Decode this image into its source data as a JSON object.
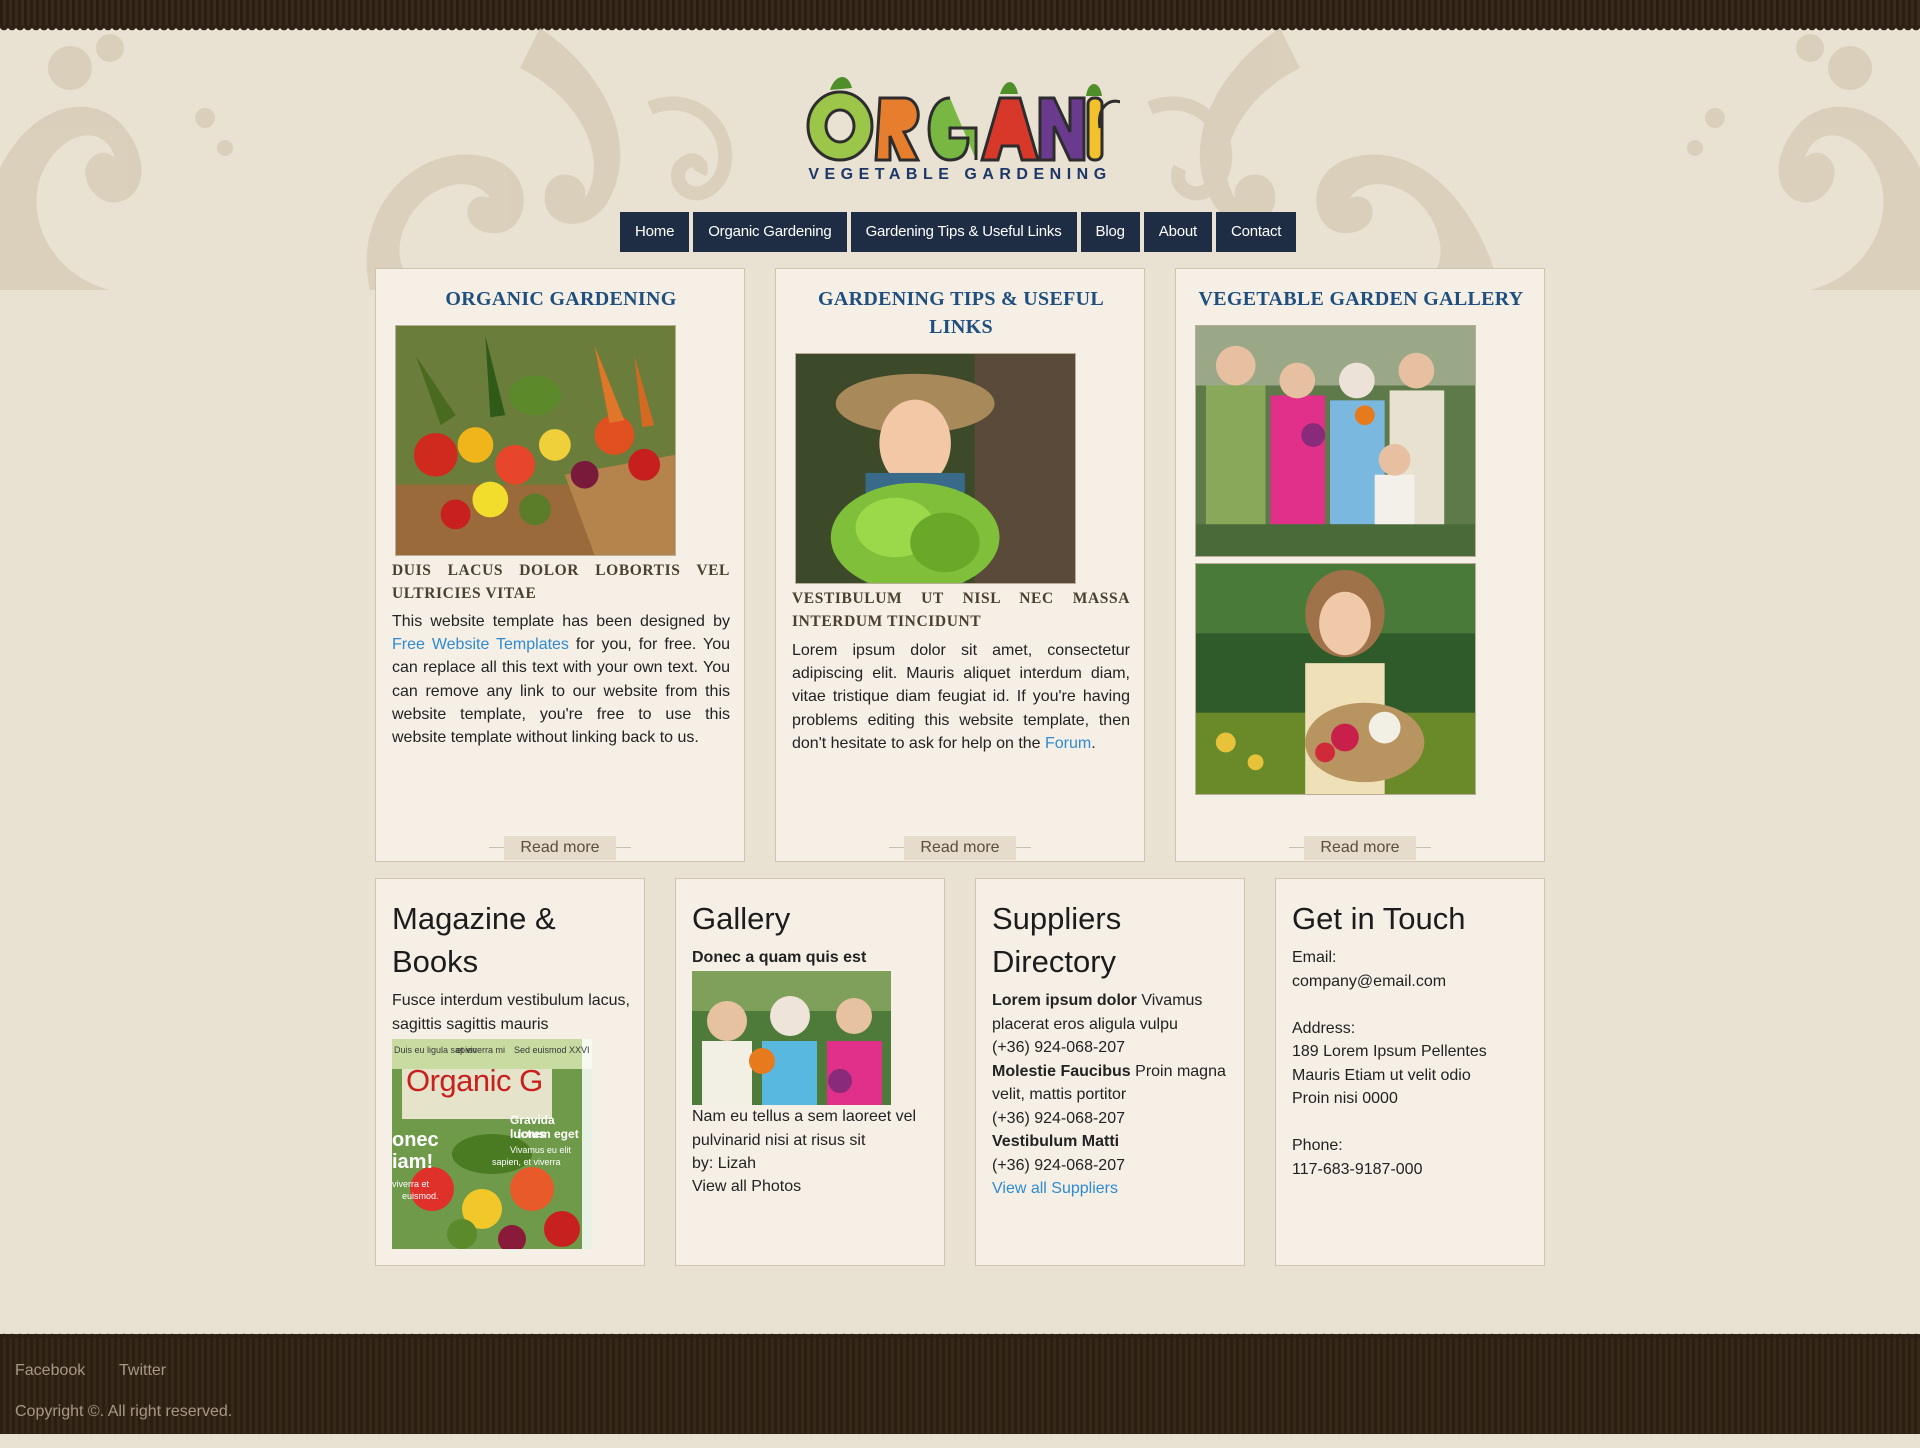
{
  "brand": {
    "logo_word": "ORGANIC",
    "logo_sub": "VEGETABLE GARDENING"
  },
  "nav": [
    {
      "label": "Home"
    },
    {
      "label": "Organic Gardening"
    },
    {
      "label": "Gardening Tips & Useful Links"
    },
    {
      "label": "Blog"
    },
    {
      "label": "About"
    },
    {
      "label": "Contact"
    }
  ],
  "featured": [
    {
      "title": "ORGANIC GARDENING",
      "subtitle": "DUIS LACUS DOLOR LOBORTIS VEL ULTRICIES VITAE",
      "text_before": "This website template has been designed by ",
      "link": "Free Website Templates",
      "text_after": " for you, for free. You can replace all this text with your own text. You can remove any link to our website from this website template, you're free to use this website template without linking back to us.",
      "read_more": "Read more"
    },
    {
      "title": "GARDENING TIPS & USEFUL LINKS",
      "subtitle": "VESTIBULUM UT NISL NEC MASSA INTERDUM TINCIDUNT",
      "text_before": "Lorem ipsum dolor sit amet, consectetur adipiscing elit. Mauris aliquet interdum diam, vitae tristique diam feugiat id. If you're having problems editing this website template, then don't hesitate to ask for help on the ",
      "link": "Forum",
      "text_after": ".",
      "read_more": "Read more"
    },
    {
      "title": "VEGETABLE GARDEN GALLERY",
      "read_more": "Read more"
    }
  ],
  "magazine": {
    "title": "Magazine & Books",
    "text": "Fusce interdum vestibulum lacus, sagittis sagittis mauris",
    "cover_title": "Organic G",
    "cover_lines": [
      "Duis eu ligula sapien",
      "et viverra mi",
      "Sed euismod XXVI",
      "Gravida luctus",
      "lorem eget",
      "Vivamus eu elit",
      "sapien, et viverra",
      "onec",
      "iam!",
      "viverra et",
      "euismod."
    ]
  },
  "gallery": {
    "title": "Gallery",
    "caption": "Donec a quam quis est",
    "text": "Nam eu tellus a sem laoreet vel pulvinarid nisi at risus sit",
    "by": "by: Lizah",
    "link": "View all Photos"
  },
  "suppliers": {
    "title": "Suppliers Directory",
    "entries": [
      {
        "name": "Lorem ipsum dolor",
        "desc": " Vivamus placerat eros aligula vulpu",
        "phone": "(+36) 924-068-207"
      },
      {
        "name": "Molestie Faucibus",
        "desc": " Proin magna velit, mattis portitor",
        "phone": "(+36) 924-068-207"
      },
      {
        "name": "Vestibulum Matti",
        "desc": "",
        "phone": "(+36) 924-068-207"
      }
    ],
    "link": "View all Suppliers"
  },
  "contact": {
    "title": "Get in Touch",
    "email_label": "Email:",
    "email": "company@email.com",
    "address_label": "Address:",
    "address_lines": [
      "189 Lorem Ipsum Pellentes",
      "Mauris Etiam ut velit odio",
      "Proin nisi 0000"
    ],
    "phone_label": "Phone:",
    "phone": "117-683-9187-000"
  },
  "footer": {
    "links": [
      {
        "label": "Facebook"
      },
      {
        "label": "Twitter"
      }
    ],
    "copyright": "Copyright ©. All right reserved."
  },
  "colors": {
    "nav_bg": "#1e2d44",
    "heading_blue": "#1e4f7f",
    "link_blue": "#2e8bd3",
    "card_bg": "#f5efe5",
    "page_bg": "#e9e1d2",
    "dark_brown": "#2e2014"
  }
}
